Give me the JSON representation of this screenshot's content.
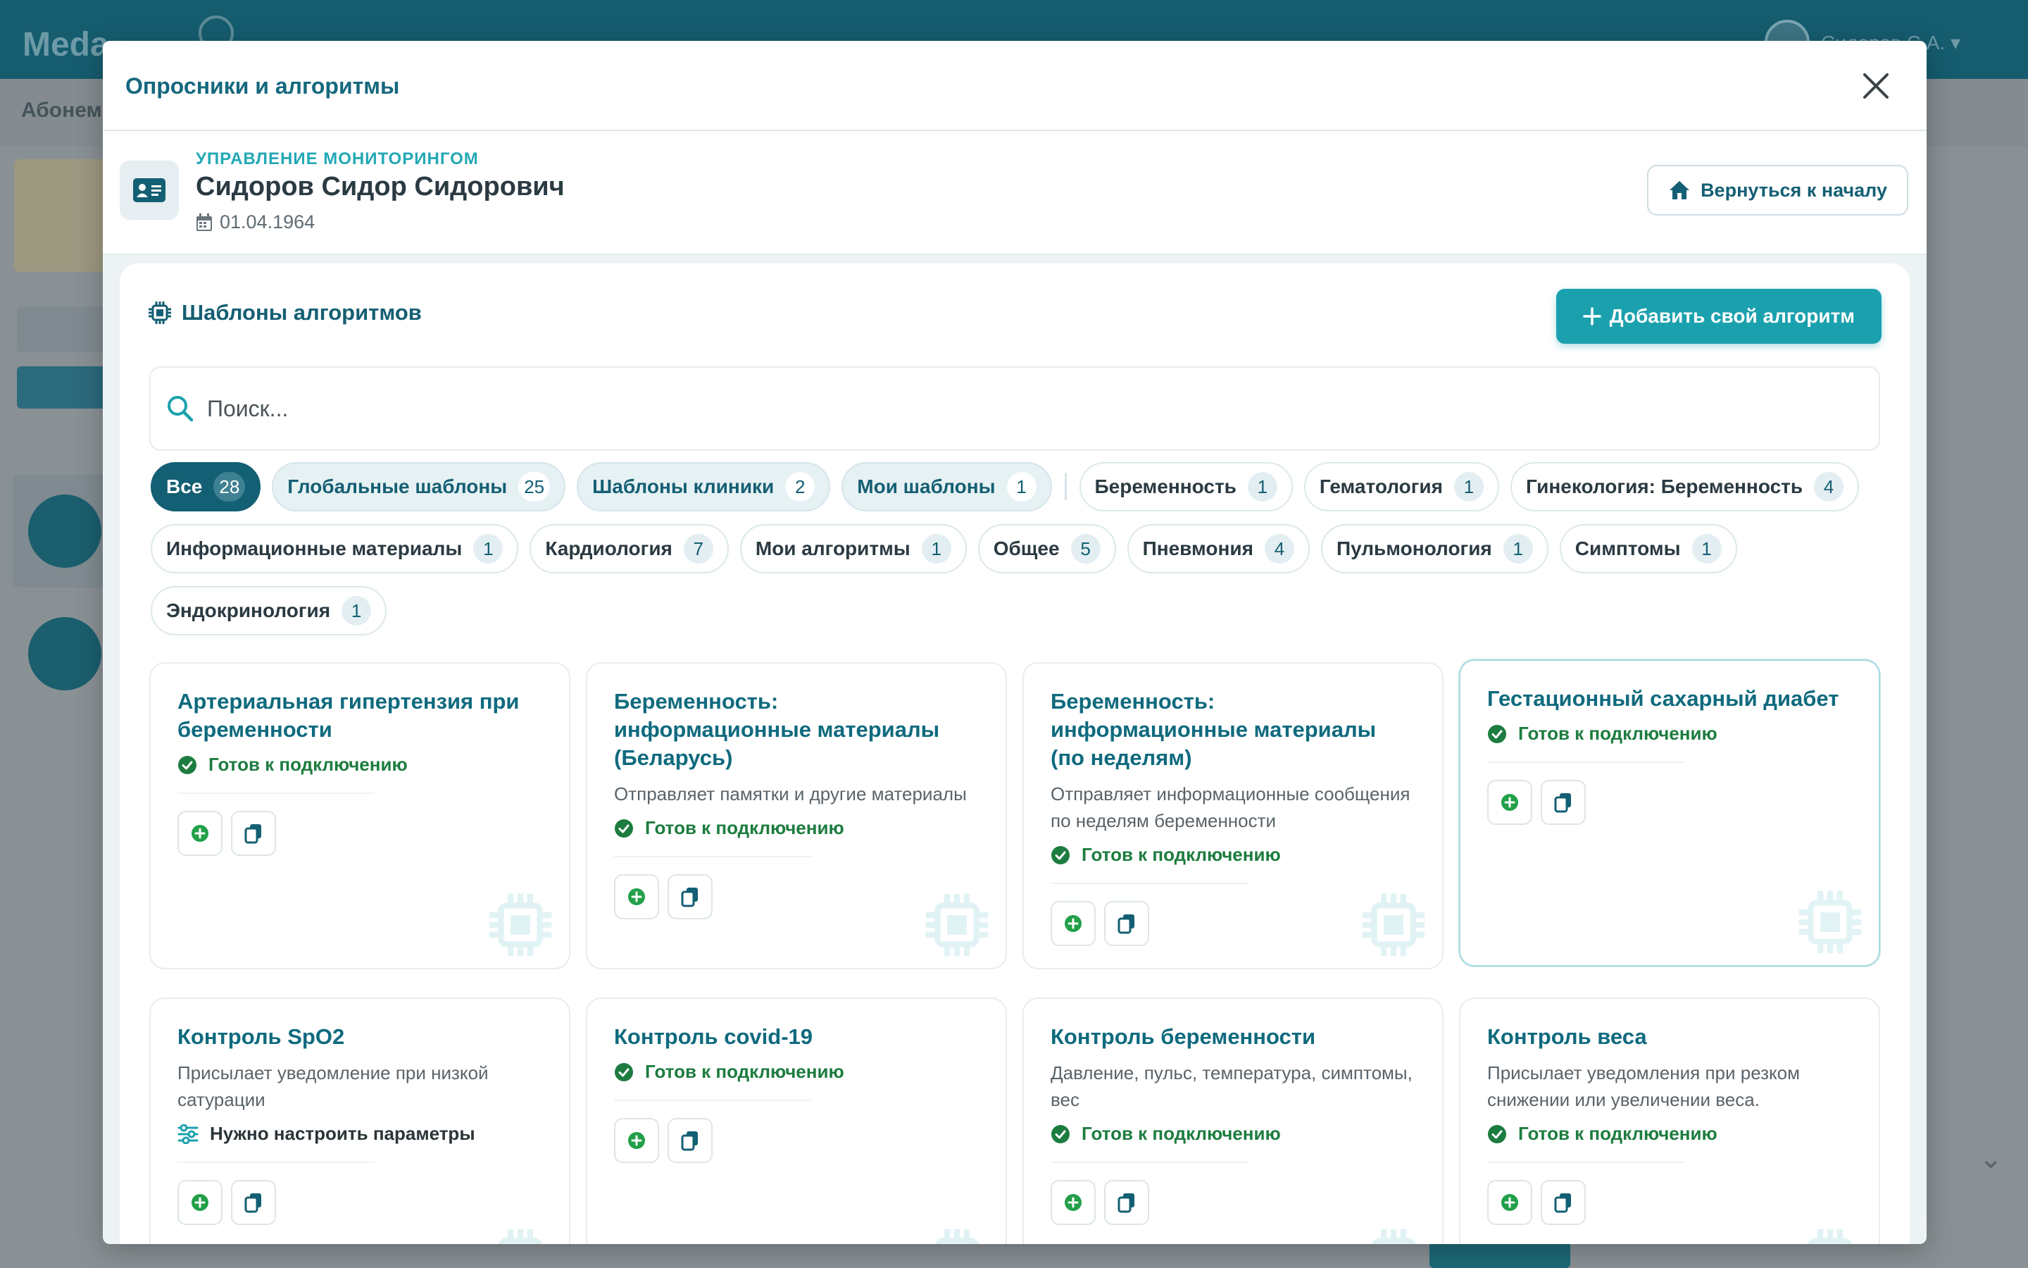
{
  "background": {
    "logo": "Meda",
    "user_name": "Сидоров С.А. ▾",
    "subbar_text": "Абонем"
  },
  "modal": {
    "title": "Опросники и алгоритмы",
    "close_icon": "close-icon"
  },
  "patient": {
    "kicker": "УПРАВЛЕНИЕ МОНИТОРИНГОМ",
    "name": "Сидоров Сидор Сидорович",
    "dob": "01.04.1964",
    "home_button": "Вернуться к началу"
  },
  "section": {
    "title": "Шаблоны алгоритмов",
    "add_button": "Добавить свой алгоритм",
    "search_placeholder": "Поиск..."
  },
  "filters": [
    {
      "label": "Все",
      "count": "28",
      "style": "active"
    },
    {
      "label": "Глобальные шаблоны",
      "count": "25",
      "style": "tinted"
    },
    {
      "label": "Шаблоны клиники",
      "count": "2",
      "style": "tinted"
    },
    {
      "label": "Мои шаблоны",
      "count": "1",
      "style": "tinted"
    },
    {
      "label": "Беременность",
      "count": "1",
      "style": "plain"
    },
    {
      "label": "Гематология",
      "count": "1",
      "style": "plain"
    },
    {
      "label": "Гинекология: Беременность",
      "count": "4",
      "style": "plain"
    },
    {
      "label": "Информационные материалы",
      "count": "1",
      "style": "plain"
    },
    {
      "label": "Кардиология",
      "count": "7",
      "style": "plain"
    },
    {
      "label": "Мои алгоритмы",
      "count": "1",
      "style": "plain"
    },
    {
      "label": "Общее",
      "count": "5",
      "style": "plain"
    },
    {
      "label": "Пневмония",
      "count": "4",
      "style": "plain"
    },
    {
      "label": "Пульмонология",
      "count": "1",
      "style": "plain"
    },
    {
      "label": "Симптомы",
      "count": "1",
      "style": "plain"
    },
    {
      "label": "Эндокринология",
      "count": "1",
      "style": "plain"
    }
  ],
  "cards": [
    {
      "title": "Артериальная гипертензия при беременности",
      "desc": "",
      "status": "Готов к подключению",
      "status_type": "ready"
    },
    {
      "title": "Беременность: информационные материалы (Беларусь)",
      "desc": "Отправляет памятки и другие материалы",
      "status": "Готов к подключению",
      "status_type": "ready"
    },
    {
      "title": "Беременность: информационные материалы (по неделям)",
      "desc": "Отправляет информационные сообщения по неделям беременности",
      "status": "Готов к подключению",
      "status_type": "ready"
    },
    {
      "title": "Гестационный сахарный диабет",
      "desc": "",
      "status": "Готов к подключению",
      "status_type": "ready",
      "highlight": true
    },
    {
      "title": "Контроль SpO2",
      "desc": "Присылает уведомление при низкой сатурации",
      "status": "Нужно настроить параметры",
      "status_type": "config"
    },
    {
      "title": "Контроль covid-19",
      "desc": "",
      "status": "Готов к подключению",
      "status_type": "ready"
    },
    {
      "title": "Контроль беременности",
      "desc": "Давление, пульс, температура, симптомы, вес",
      "status": "Готов к подключению",
      "status_type": "ready"
    },
    {
      "title": "Контроль веса",
      "desc": "Присылает уведомления при резком снижении или увеличении веса.",
      "status": "Готов к подключению",
      "status_type": "ready"
    }
  ],
  "colors": {
    "accent": "#1ba1ae",
    "primary_dark": "#135f73",
    "ready_green": "#1d7c3f"
  }
}
